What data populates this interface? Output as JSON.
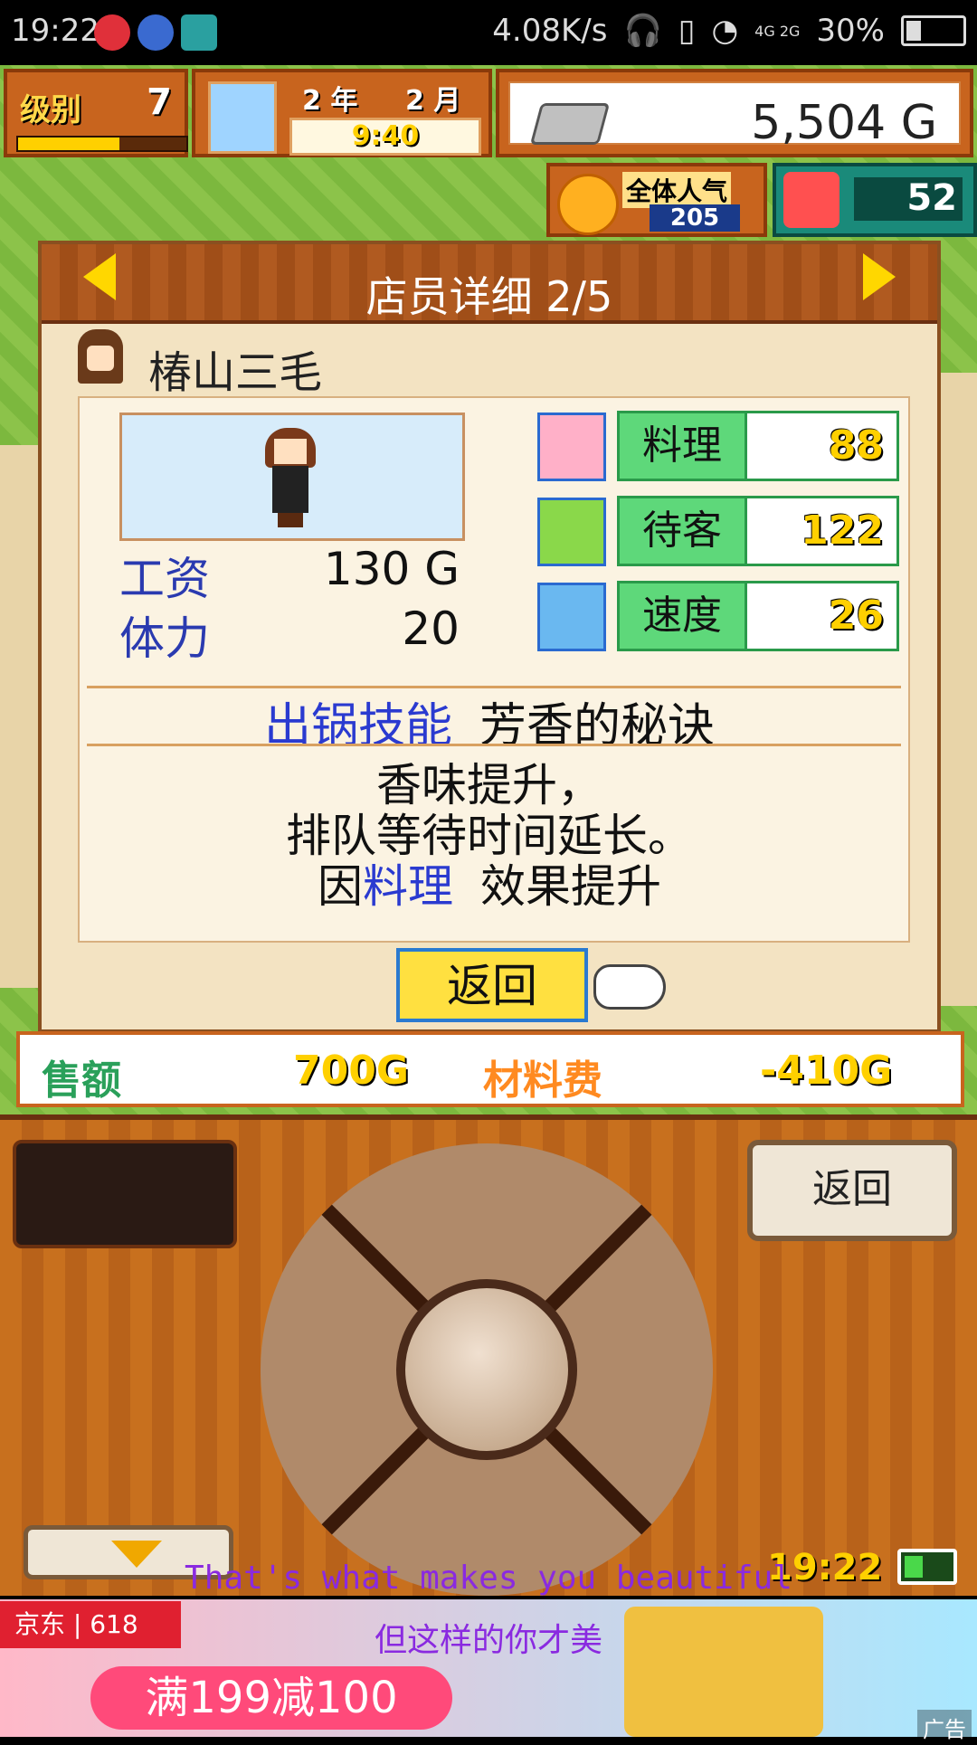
{
  "status_bar": {
    "time": "19:22",
    "net_speed": "4.08K/s",
    "signal": "4G 2G",
    "battery": "30%",
    "battery_fraction": 0.3
  },
  "hud": {
    "level_label": "级别",
    "level": "7",
    "level_progress": 0.6,
    "year": "2 年",
    "month": "2 月",
    "clock": "9:40",
    "money": "5,504 G",
    "popularity_label": "全体人气",
    "popularity": "205",
    "trophy": "52"
  },
  "dialog": {
    "title": "店员详细 2/5",
    "employee_name": "椿山三毛",
    "salary_label": "工资",
    "salary_value": "130 G",
    "stamina_label": "体力",
    "stamina_value": "20",
    "skills": [
      {
        "label": "料理",
        "value": "88",
        "icon": "bowl-icon"
      },
      {
        "label": "待客",
        "value": "122",
        "icon": "drumstick-icon"
      },
      {
        "label": "速度",
        "value": "26",
        "icon": "rocket-icon"
      }
    ],
    "ability_key": "出锅技能",
    "ability_name": "芳香的秘诀",
    "desc_line1": "香味提升，",
    "desc_line2": "排队等待时间延长。",
    "desc_line3_pre": "因",
    "desc_line3_hl": "料理",
    "desc_line3_post": "效果提升",
    "return_label": "返回"
  },
  "summary": {
    "sales_label": "售额",
    "sales_value": "700G",
    "material_label": "材料费",
    "material_value": "-410G"
  },
  "controller": {
    "back_label": "返回",
    "clock": "19:22"
  },
  "overlay": {
    "lyric_en": "That's what makes you beautiful",
    "lyric_zh": "但这样的你才美"
  },
  "ad": {
    "brand": "京东 | 618",
    "cta": "满199减100",
    "mark": "广告"
  },
  "colors": {
    "panel_bg": "#f3e3c2",
    "header_wood": "#b05a20",
    "accent_blue": "#2a3ad0",
    "skill_green": "#5ed87a",
    "button_yellow": "#ffe040"
  }
}
